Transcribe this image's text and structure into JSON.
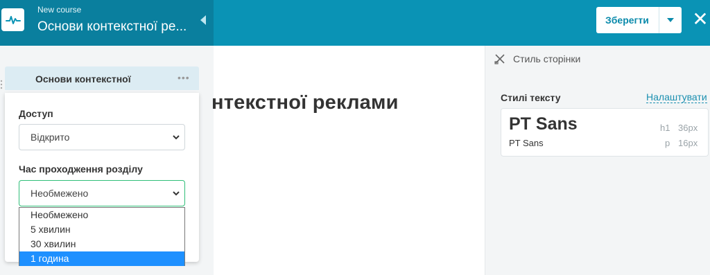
{
  "header": {
    "subtitle": "New course",
    "course_title": "Основи контекстної ре...",
    "save_label": "Зберегти",
    "close_symbol": "✕"
  },
  "left_panel": {
    "section_title": "Основи контекстної",
    "section_menu": "•••",
    "access_label": "Доступ",
    "access_value": "Відкрито",
    "duration_label": "Час проходження розділу",
    "duration_value": "Необмежено",
    "duration_options": [
      "Необмежено",
      "5 хвилин",
      "30 хвилин",
      "1 година"
    ],
    "highlighted_option": "1 година"
  },
  "main": {
    "heading": "нтекстної реклами"
  },
  "right_panel": {
    "page_style_label": "Стиль сторінки",
    "text_styles_label": "Стилі тексту",
    "settings_link": "Налаштувати",
    "font_heading": "PT Sans",
    "font_body": "PT Sans",
    "h1_tag": "h1",
    "h1_size": "36px",
    "p_tag": "p",
    "p_size": "16px"
  },
  "colors": {
    "topbar": "#0a93b5",
    "topbar_left": "#0a7f9e",
    "accent_text": "#0a8aab",
    "focus_border": "#2fbe78",
    "selected_option": "#1e90ff",
    "link": "#1a8fb0"
  },
  "icons": {
    "logo": "pulse-icon",
    "collapse": "chevron-left-icon",
    "save_dropdown": "caret-down-icon",
    "close": "close-icon",
    "page_style": "brush-ruler-icon"
  }
}
